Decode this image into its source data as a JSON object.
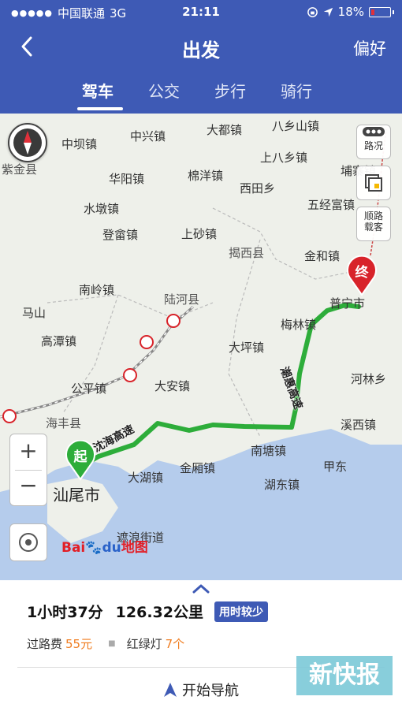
{
  "status_bar": {
    "signal": "●●●●●",
    "carrier": "中国联通",
    "network": "3G",
    "time": "21:11",
    "battery": "18%"
  },
  "nav": {
    "title": "出发",
    "preferences_label": "偏好"
  },
  "tabs": [
    {
      "label": "驾车",
      "active": true
    },
    {
      "label": "公交",
      "active": false
    },
    {
      "label": "步行",
      "active": false
    },
    {
      "label": "骑行",
      "active": false
    }
  ],
  "map": {
    "side_buttons": {
      "traffic": "路况",
      "carpool_line1": "顺路",
      "carpool_line2": "载客"
    },
    "places": {
      "zijinxian": "紫金县",
      "zhongba": "中坝镇",
      "zhongxing": "中兴镇",
      "dadu": "大都镇",
      "baxiang": "八乡山镇",
      "huayang": "华阳镇",
      "mianyang": "棉洋镇",
      "shangbaxiang": "上八乡镇",
      "bupai": "埔寨镇",
      "shuidun": "水墩镇",
      "xitian": "西田乡",
      "wujingfu": "五经富镇",
      "dengyong": "登畲镇",
      "shangsha": "上砂镇",
      "jiexi": "揭西县",
      "jinhe": "金和镇",
      "nanling": "南岭镇",
      "luhe": "陆河县",
      "mashan": "马山",
      "meilin": "梅林镇",
      "gaotan": "高潭镇",
      "daping": "大坪镇",
      "heshi": "河林乡",
      "gongping": "公平镇",
      "daan": "大安镇",
      "xixi": "溪西镇",
      "haifeng": "海丰县",
      "nantang": "南塘镇",
      "jiadong": "甲东",
      "dahu": "大湖镇",
      "jinxiang": "金厢镇",
      "hudong": "湖东镇",
      "shanwei": "汕尾市",
      "zhelang": "遮浪街道",
      "puning": "普宁市"
    },
    "roads": {
      "shenhai": "沈海高速",
      "chaohui": "潮惠高速"
    },
    "markers": {
      "start": "起",
      "end": "终"
    },
    "logo": {
      "bai": "Bai",
      "du": "du",
      "ditu": "地图"
    }
  },
  "route": {
    "duration": "1小时37分",
    "distance": "126.32公里",
    "tag": "用时较少",
    "toll_label": "过路费",
    "toll_value": "55元",
    "lights_label": "红绿灯",
    "lights_value": "7个"
  },
  "actions": {
    "start_navigation": "开始导航"
  },
  "watermark": "新快报",
  "colors": {
    "header": "#3e5ab5",
    "route": "#2dad3a",
    "accent_orange": "#f07d20",
    "end_marker": "#d8232a"
  }
}
